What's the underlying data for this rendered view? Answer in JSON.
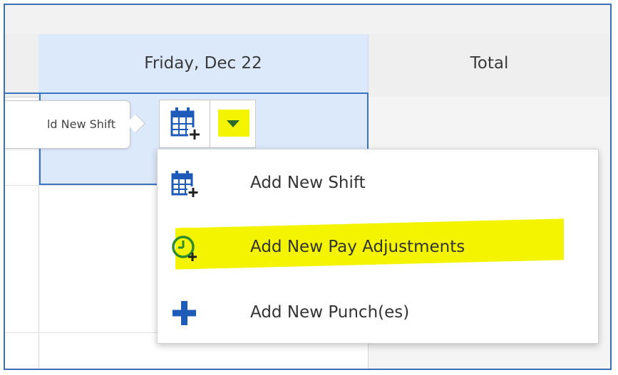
{
  "header": {
    "day_label": "Friday, Dec 22",
    "total_label": "Total"
  },
  "cell_actions": {
    "tooltip_text": "ld New Shift",
    "add_shift_icon": "calendar-plus-icon",
    "dropdown_icon": "caret-down-icon"
  },
  "menu": {
    "items": [
      {
        "label": "Add New Shift",
        "icon": "calendar-plus-icon"
      },
      {
        "label": "Add New Pay Adjustments",
        "icon": "clock-plus-icon"
      },
      {
        "label": "Add New Punch(es)",
        "icon": "plus-icon"
      }
    ]
  },
  "colors": {
    "accent_blue": "#1e5bb8",
    "highlight_yellow": "#f4f400",
    "selected_cell_bg": "#dce9fb",
    "clock_green": "#2e8b2e"
  }
}
